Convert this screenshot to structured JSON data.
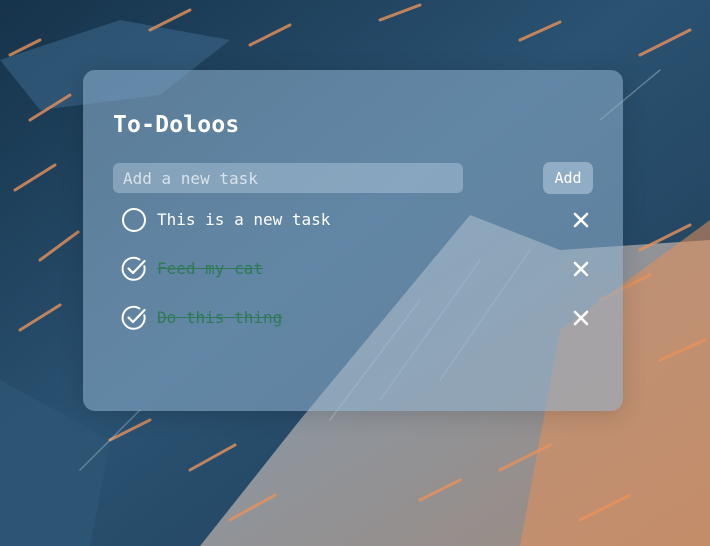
{
  "app": {
    "title": "To-Doloos"
  },
  "new_task": {
    "placeholder": "Add a new task",
    "value": "",
    "add_label": "Add"
  },
  "tasks": [
    {
      "text": "This is a new task",
      "done": false
    },
    {
      "text": "Feed my cat",
      "done": true
    },
    {
      "text": "Do this thing",
      "done": true
    }
  ],
  "icons": {
    "toggle_open": "circle-icon",
    "toggle_done": "check-circle-icon",
    "delete": "close-icon"
  },
  "colors": {
    "card": "#8fb2d0",
    "completed_text": "#2f7a56",
    "background_dark": "#1d3a52",
    "background_accent": "#e08a55"
  }
}
